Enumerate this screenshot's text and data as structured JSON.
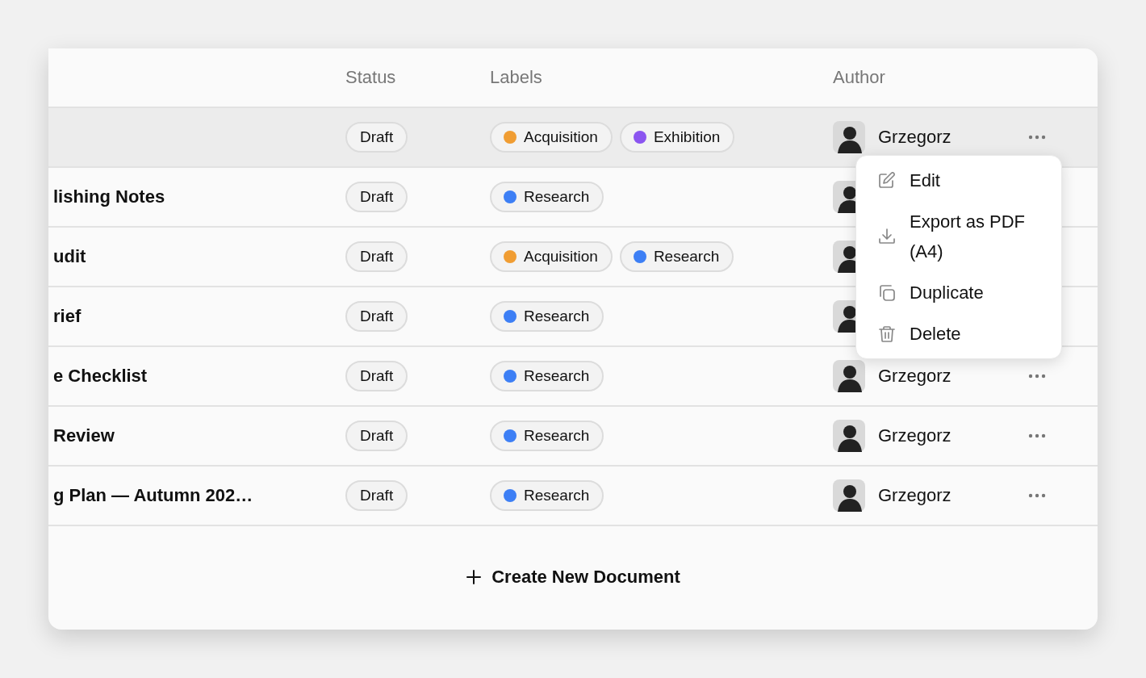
{
  "table": {
    "columns": [
      "Status",
      "Labels",
      "Author"
    ],
    "rows": [
      {
        "selected": true,
        "status": "Draft",
        "labels": [
          {
            "name": "Acquisition",
            "color": "#f09d33"
          },
          {
            "name": "Exhibition",
            "color": "#8b55f0"
          }
        ],
        "author": "Grzegorz"
      },
      {
        "selected": false,
        "title": "lishing Notes",
        "status": "Draft",
        "labels": [
          {
            "name": "Research",
            "color": "#3d7ff5"
          }
        ]
      },
      {
        "selected": false,
        "title": "udit",
        "status": "Draft",
        "labels": [
          {
            "name": "Acquisition",
            "color": "#f09d33"
          },
          {
            "name": "Research",
            "color": "#3d7ff5"
          }
        ]
      },
      {
        "selected": false,
        "title": "rief",
        "status": "Draft",
        "labels": [
          {
            "name": "Research",
            "color": "#3d7ff5"
          }
        ]
      },
      {
        "selected": false,
        "title": "e Checklist",
        "status": "Draft",
        "labels": [
          {
            "name": "Research",
            "color": "#3d7ff5"
          }
        ],
        "author": "Grzegorz"
      },
      {
        "selected": false,
        "title": "Review",
        "status": "Draft",
        "labels": [
          {
            "name": "Research",
            "color": "#3d7ff5"
          }
        ],
        "author": "Grzegorz"
      },
      {
        "selected": false,
        "title": "g Plan — Autumn 202…",
        "status": "Draft",
        "labels": [
          {
            "name": "Research",
            "color": "#3d7ff5"
          }
        ],
        "author": "Grzegorz"
      }
    ]
  },
  "create_button": {
    "label": "Create New Document"
  },
  "context_menu": {
    "items": [
      {
        "kind": "edit",
        "label": "Edit"
      },
      {
        "kind": "export",
        "label": "Export as PDF (A4)"
      },
      {
        "kind": "duplicate",
        "label": "Duplicate"
      },
      {
        "kind": "delete",
        "label": "Delete"
      }
    ]
  }
}
